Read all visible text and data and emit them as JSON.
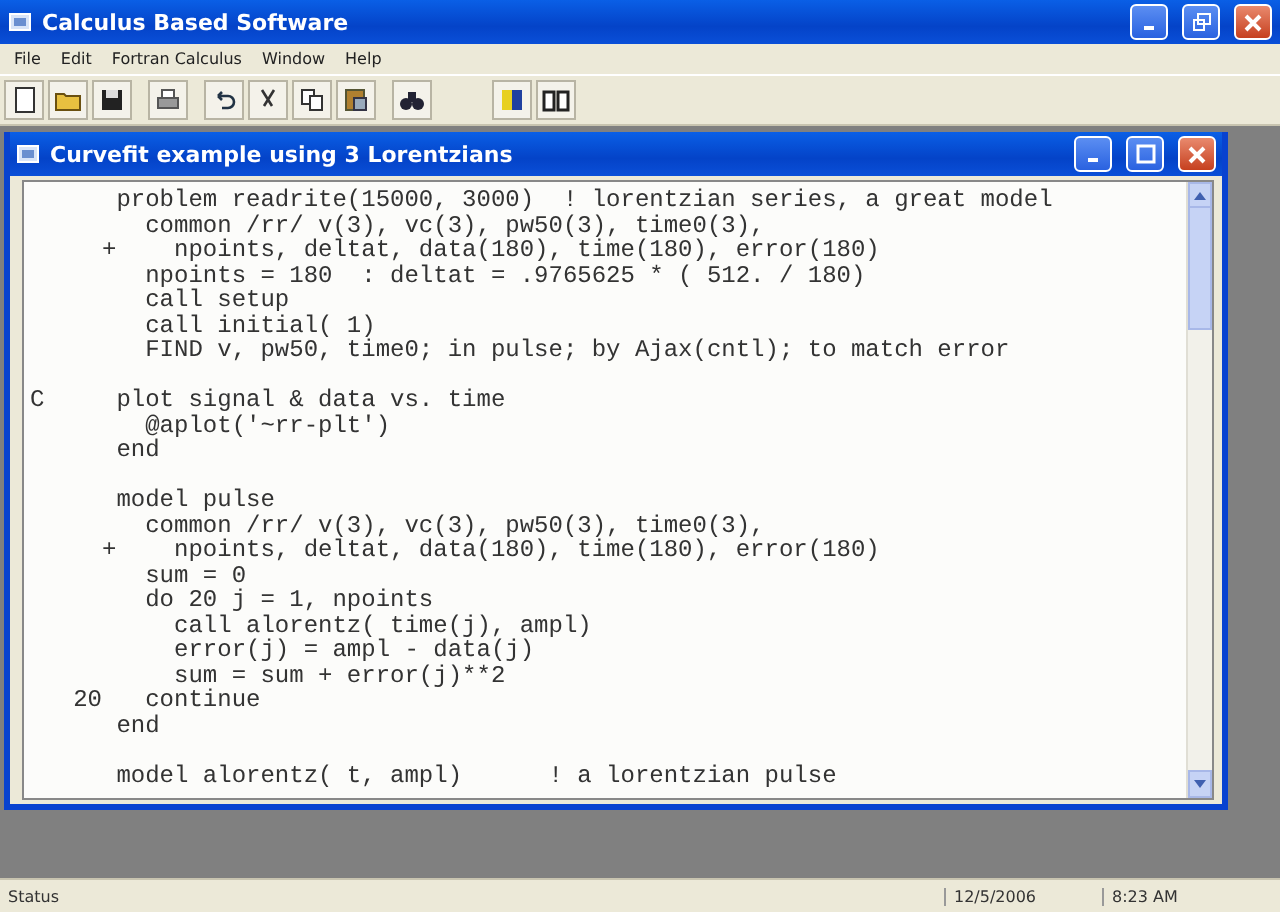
{
  "window": {
    "title": "Calculus Based Software"
  },
  "menu": [
    "File",
    "Edit",
    "Fortran Calculus",
    "Window",
    "Help"
  ],
  "child_window": {
    "title": "Curvefit example using 3 Lorentzians",
    "blocks": [
      {
        "lines": [
          "      problem readrite(15000, 3000)  ! lorentzian series, a great model",
          "        common /rr/ v(3), vc(3), pw50(3), time0(3),",
          "     +    npoints, deltat, data(180), time(180), error(180)",
          "        npoints = 180  : deltat = .9765625 * ( 512. / 180)",
          "        call setup",
          "        call initial( 1)",
          "        FIND v, pw50, time0; in pulse; by Ajax(cntl); to match error"
        ]
      },
      {
        "lines": [
          "C     plot signal & data vs. time",
          "        @aplot('~rr-plt')",
          "      end"
        ]
      },
      {
        "lines": [
          "      model pulse",
          "        common /rr/ v(3), vc(3), pw50(3), time0(3),",
          "     +    npoints, deltat, data(180), time(180), error(180)",
          "        sum = 0",
          "        do 20 j = 1, npoints",
          "          call alorentz( time(j), ampl)",
          "          error(j) = ampl - data(j)",
          "          sum = sum + error(j)**2",
          "   20   continue",
          "      end"
        ]
      },
      {
        "lines": [
          "      model alorentz( t, ampl)      ! a lorentzian pulse"
        ]
      }
    ]
  },
  "status_bar": {
    "text": "Status",
    "date": "12/5/2006",
    "time": "8:23 AM"
  }
}
